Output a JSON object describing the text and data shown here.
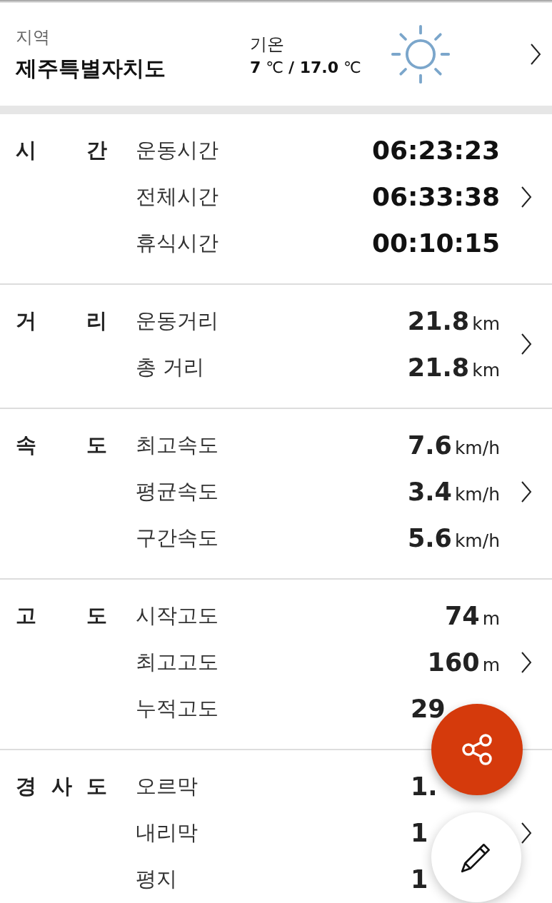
{
  "header": {
    "region_label": "지역",
    "region": "제주특별자치도",
    "temp_label": "기온",
    "temperature": "**7** ℃ **/ 17.0** ℃"
  },
  "sections": [
    {
      "category": "시간",
      "rows": [
        {
          "label": "운동시간",
          "value": "06:23:23",
          "kind": "time"
        },
        {
          "label": "전체시간",
          "value": "06:33:38",
          "kind": "time"
        },
        {
          "label": "휴식시간",
          "value": "00:10:15",
          "kind": "time"
        }
      ]
    },
    {
      "category": "거리",
      "rows": [
        {
          "label": "운동거리",
          "value": "21.8",
          "unit": "km",
          "kind": "measure"
        },
        {
          "label": "총 거리",
          "value": "21.8",
          "unit": "km",
          "kind": "measure"
        }
      ]
    },
    {
      "category": "속도",
      "rows": [
        {
          "label": "최고속도",
          "value": "7.6",
          "unit": "km/h",
          "kind": "measure"
        },
        {
          "label": "평균속도",
          "value": "3.4",
          "unit": "km/h",
          "kind": "measure"
        },
        {
          "label": "구간속도",
          "value": "5.6",
          "unit": "km/h",
          "kind": "measure"
        }
      ]
    },
    {
      "category": "고도",
      "rows": [
        {
          "label": "시작고도",
          "value": "74",
          "unit": "m",
          "kind": "measure"
        },
        {
          "label": "최고고도",
          "value": "160",
          "unit": "m",
          "kind": "measure"
        },
        {
          "label": "누적고도",
          "value": "29",
          "kind": "cut"
        }
      ]
    },
    {
      "category": "경사도",
      "rows": [
        {
          "label": "오르막",
          "value": "1.",
          "kind": "cut"
        },
        {
          "label": "내리막",
          "value": "1",
          "kind": "cut"
        },
        {
          "label": "평지",
          "value": "1",
          "kind": "cut"
        }
      ]
    }
  ]
}
